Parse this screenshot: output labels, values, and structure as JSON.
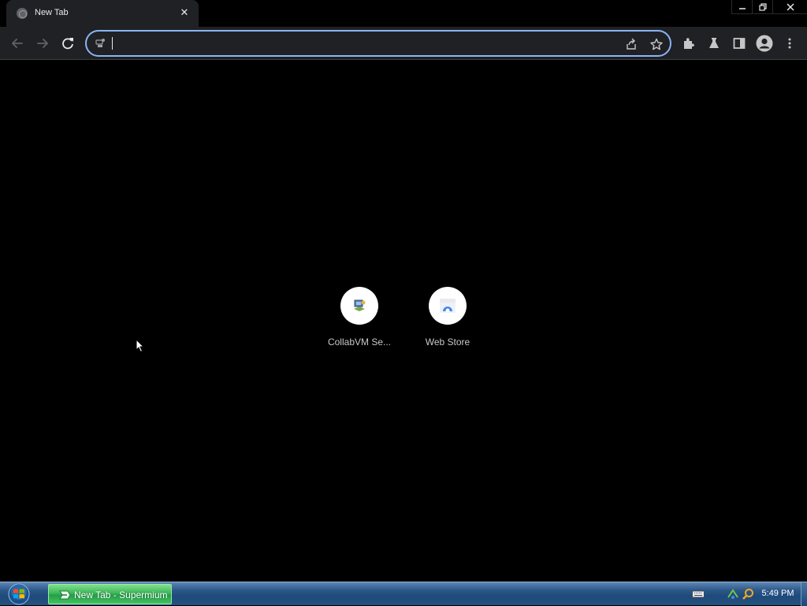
{
  "browser": {
    "tab": {
      "title": "New Tab",
      "close_glyph": "✕",
      "favicon": "globe-icon"
    },
    "window_controls": {
      "minimize": "minimize-icon",
      "restore": "restore-icon",
      "close": "close-icon"
    },
    "toolbar": {
      "back": "arrow-back-icon",
      "forward": "arrow-forward-icon",
      "reload": "reload-icon",
      "omnibox": {
        "value": "",
        "placeholder": ""
      },
      "share": "share-icon",
      "bookmark": "star-icon",
      "extensions": "puzzle-icon",
      "labs": "flask-icon",
      "side_panel": "side-panel-icon",
      "profile": "account-icon",
      "menu": "more-vert-icon"
    }
  },
  "ntp": {
    "shortcuts": [
      {
        "label": "CollabVM Se...",
        "icon": "collabvm-icon"
      },
      {
        "label": "Web Store",
        "icon": "web-store-icon"
      }
    ]
  },
  "taskbar": {
    "start": "windows-start-orb",
    "active_task": {
      "label": "New Tab - Supermium",
      "icon": "supermium-icon"
    },
    "tray": [
      "keyboard-icon",
      "network-icon",
      "search-icon"
    ],
    "clock": "5:49 PM"
  },
  "colors": {
    "accent": "#8ab4f8",
    "toolbar": "#202124",
    "taskbar_active": "#3cb65a"
  }
}
